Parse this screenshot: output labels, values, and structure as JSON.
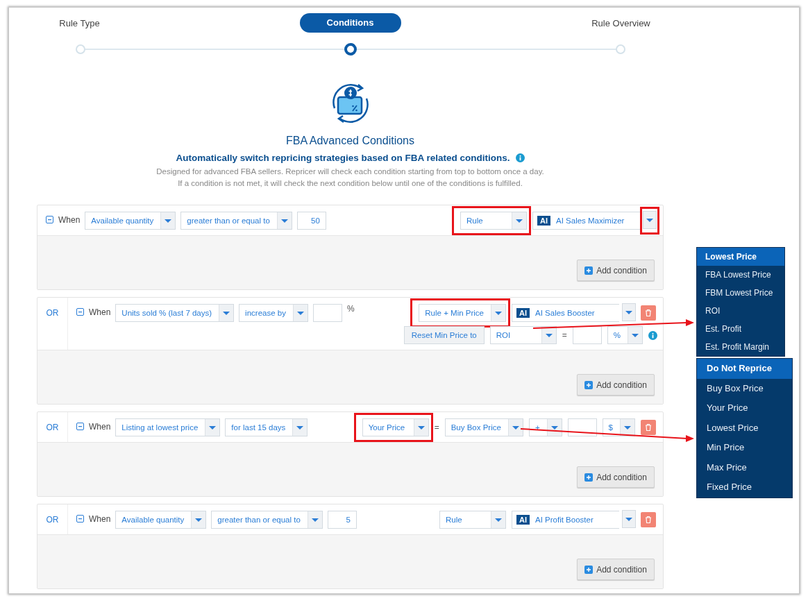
{
  "steps": [
    {
      "label": "Rule Type",
      "selected": false
    },
    {
      "label": "Conditions",
      "selected": true
    },
    {
      "label": "Rule Overview",
      "selected": false
    }
  ],
  "heading": {
    "title": "FBA Advanced Conditions",
    "subtitle": "Automatically switch repricing strategies based on FBA related conditions.",
    "description": [
      "Designed for advanced FBA sellers. Repricer will check each condition starting from top to bottom once a day.",
      "If a condition is not met, it will check the next condition below until one of the conditions is fulfilled."
    ]
  },
  "conditions": [
    {
      "when": "When",
      "fields": [
        {
          "kind": "select",
          "value": "Available quantity",
          "highlighted": false
        },
        {
          "kind": "select",
          "value": "greater than or equal to",
          "highlighted": false
        },
        {
          "kind": "input",
          "value": "50"
        }
      ],
      "actions": [
        {
          "kind": "select",
          "value": "Rule",
          "highlighted": true
        },
        {
          "kind": "strategy",
          "badge": "AI",
          "value": "AI Sales Maximizer",
          "caret_highlighted": true
        }
      ],
      "deletable": false,
      "add_button": "Add condition"
    },
    {
      "connector": "OR",
      "when": "When",
      "fields": [
        {
          "kind": "select",
          "value": "Units sold % (last 7 days)",
          "highlighted": false
        },
        {
          "kind": "select",
          "value": "increase by",
          "highlighted": false
        },
        {
          "kind": "input"
        },
        {
          "kind": "text",
          "value": "%"
        }
      ],
      "actions": [
        {
          "kind": "select",
          "value": "Rule + Min Price",
          "highlighted": true
        },
        {
          "kind": "strategy",
          "badge": "AI",
          "value": "AI Sales Booster",
          "caret_highlighted": false
        }
      ],
      "deletable": true,
      "extra": [
        {
          "kind": "button",
          "value": "Reset Min Price to"
        },
        {
          "kind": "select",
          "value": "ROI",
          "highlighted": false
        },
        {
          "kind": "text",
          "value": "="
        },
        {
          "kind": "input"
        },
        {
          "kind": "select",
          "value": "%",
          "highlighted": false
        },
        {
          "kind": "info"
        }
      ],
      "add_button": "Add condition"
    },
    {
      "connector": "OR",
      "when": "When",
      "fields": [
        {
          "kind": "select",
          "value": "Listing at lowest price",
          "highlighted": false
        },
        {
          "kind": "select",
          "value": "for last 15 days",
          "highlighted": false
        }
      ],
      "actions": [
        {
          "kind": "select",
          "value": "Your Price",
          "highlighted": true
        },
        {
          "kind": "text",
          "value": "="
        },
        {
          "kind": "select",
          "value": "Buy Box Price",
          "highlighted": false
        },
        {
          "kind": "select",
          "value": "+",
          "highlighted": false
        },
        {
          "kind": "input"
        },
        {
          "kind": "select",
          "value": "$",
          "highlighted": false
        }
      ],
      "deletable": true,
      "add_button": "Add condition"
    },
    {
      "connector": "OR",
      "when": "When",
      "fields": [
        {
          "kind": "select",
          "value": "Available quantity",
          "highlighted": false
        },
        {
          "kind": "select",
          "value": "greater than or equal to",
          "highlighted": false
        },
        {
          "kind": "input",
          "value": "5"
        }
      ],
      "actions": [
        {
          "kind": "select",
          "value": "Rule",
          "highlighted": false
        },
        {
          "kind": "strategy",
          "badge": "AI",
          "value": "AI Profit Booster",
          "caret_highlighted": false
        }
      ],
      "deletable": true,
      "add_button": "Add condition"
    }
  ],
  "menus": [
    {
      "items": [
        {
          "label": "Lowest Price",
          "selected": true
        },
        {
          "label": "FBA Lowest Price",
          "selected": false
        },
        {
          "label": "FBM Lowest Price",
          "selected": false
        },
        {
          "label": "ROI",
          "selected": false
        },
        {
          "label": "Est. Profit",
          "selected": false
        },
        {
          "label": "Est. Profit Margin",
          "selected": false
        }
      ]
    },
    {
      "items": [
        {
          "label": "Do Not Reprice",
          "selected": true
        },
        {
          "label": "Buy Box Price",
          "selected": false
        },
        {
          "label": "Your Price",
          "selected": false
        },
        {
          "label": "Lowest Price",
          "selected": false
        },
        {
          "label": "Min Price",
          "selected": false
        },
        {
          "label": "Max Price",
          "selected": false
        },
        {
          "label": "Fixed Price",
          "selected": false
        }
      ]
    }
  ]
}
